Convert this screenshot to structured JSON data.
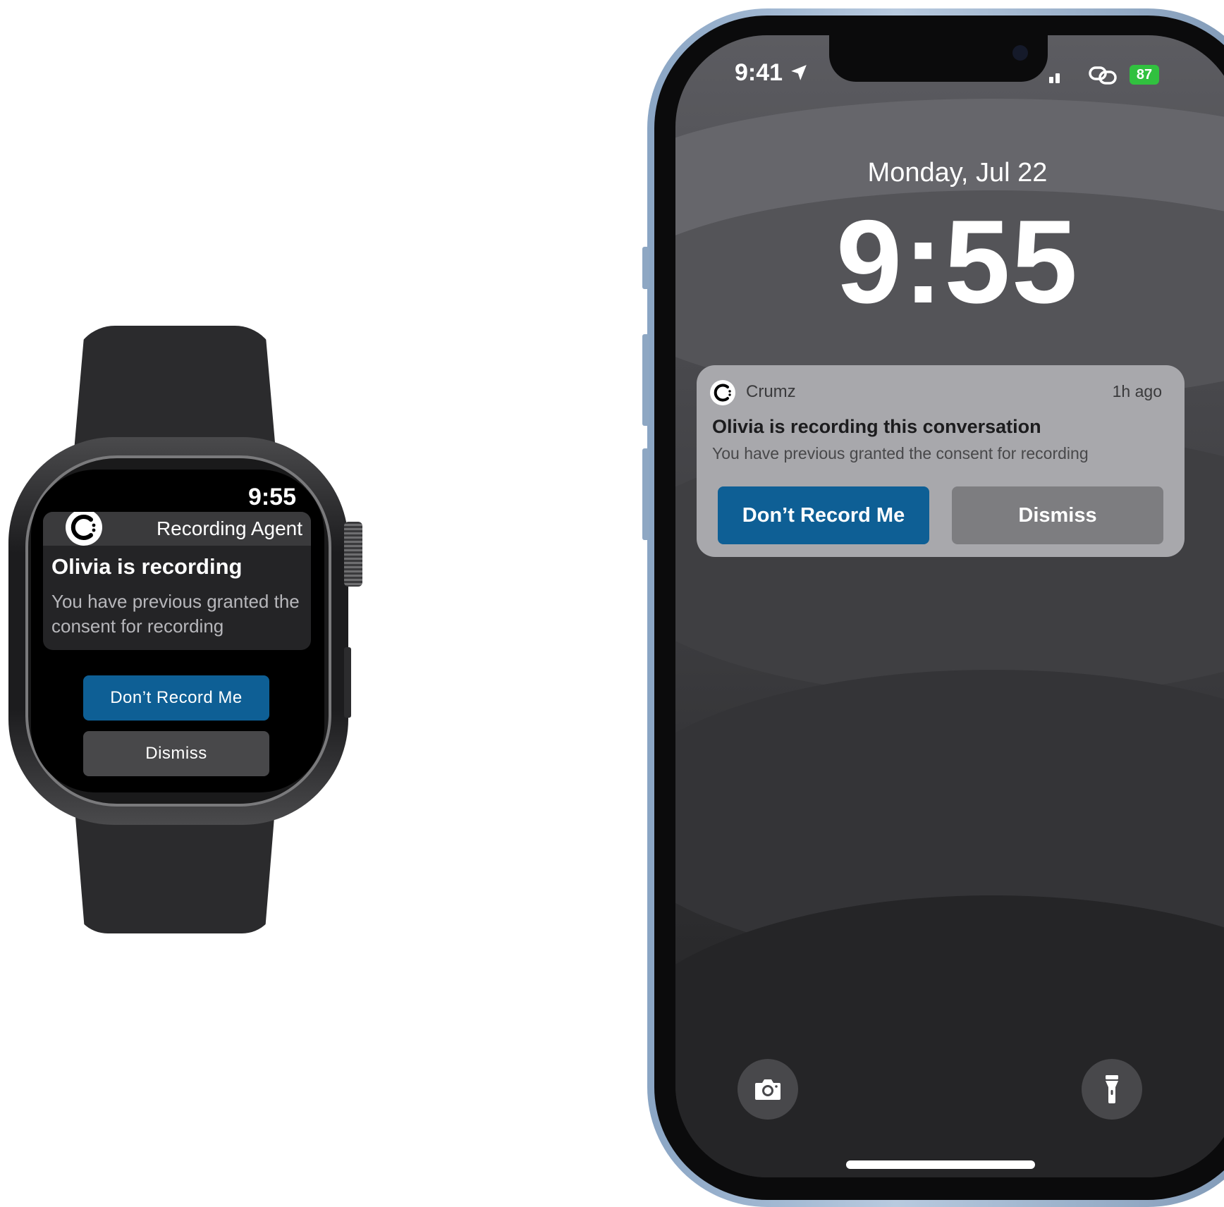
{
  "watch": {
    "time": "9:55",
    "app_name": "Recording Agent",
    "notification": {
      "title": "Olivia is recording",
      "body": "You have previous granted the consent for recording"
    },
    "buttons": {
      "dont_record": "Don’t Record Me",
      "dismiss": "Dismiss"
    }
  },
  "phone": {
    "status_bar": {
      "time": "9:41",
      "battery": "87",
      "battery_color": "#31C13F",
      "icons": [
        "location-icon",
        "signal-icon",
        "link-icon"
      ]
    },
    "lock_screen": {
      "date": "Monday, Jul 22",
      "time": "9:55"
    },
    "notification": {
      "app_name": "Crumz",
      "time_ago": "1h ago",
      "title": "Olivia is recording this conversation",
      "body": "You have previous granted  the consent for recording",
      "buttons": {
        "dont_record": "Don’t Record Me",
        "dismiss": "Dismiss"
      }
    },
    "quick_actions": [
      "camera-icon",
      "flashlight-icon"
    ]
  },
  "colors": {
    "accent": "#0E5F95"
  }
}
